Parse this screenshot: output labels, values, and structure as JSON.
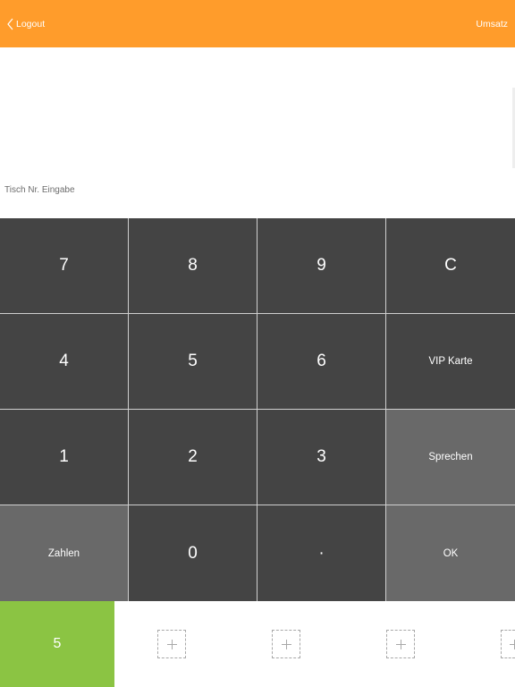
{
  "nav": {
    "back_label": "Logout",
    "right_label": "Umsatz",
    "back_icon": "chevron-left-icon",
    "bg_color": "#ff9c2b"
  },
  "entry": {
    "placeholder": "Tisch Nr. Eingabe",
    "value": ""
  },
  "keypad": {
    "keys": [
      "7",
      "8",
      "9",
      "C",
      "4",
      "5",
      "6",
      "VIP Karte",
      "1",
      "2",
      "3",
      "Sprechen",
      "Zahlen",
      "0",
      "·",
      "OK"
    ],
    "key_color": "#444444",
    "accent_key_color": "#696969"
  },
  "bottom": {
    "active_slot_label": "5",
    "active_slot_color": "#8bc443",
    "add_icon": "plus-icon"
  }
}
